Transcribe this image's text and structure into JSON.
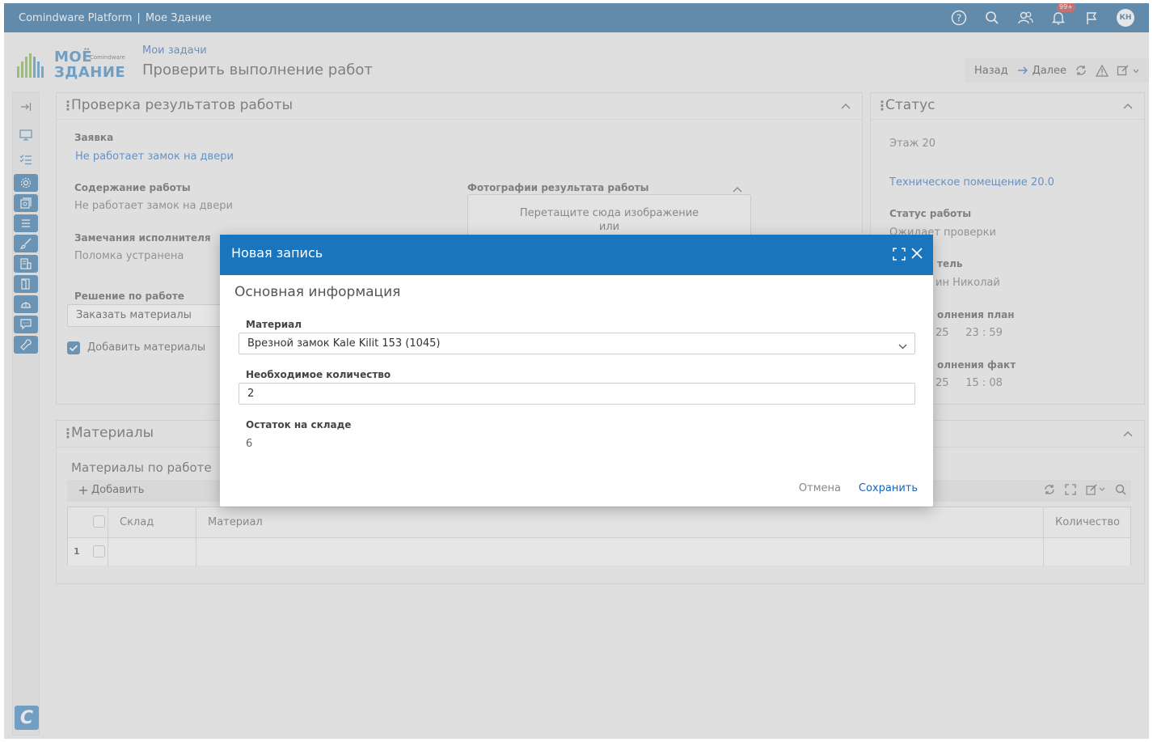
{
  "topbar": {
    "app_name": "Comindware Platform",
    "separator": "|",
    "workspace": "Мое Здание",
    "notification_count": "99+",
    "avatar_initials": "КН",
    "icons": [
      "help-icon",
      "search-icon",
      "users-icon",
      "bell-icon",
      "flag-icon"
    ]
  },
  "logo": {
    "line1": "МОЁ",
    "line2": "ЗДАНИЕ",
    "sub": "Comindware"
  },
  "header": {
    "breadcrumb": "Мои задачи",
    "title": "Проверить выполнение работ",
    "back_label": "Назад",
    "next_label": "Далее"
  },
  "panel_check": {
    "title": "Проверка результатов работы",
    "request_label": "Заявка",
    "request_value": "Не работает замок на двери",
    "content_label": "Содержание работы",
    "content_value": "Не работает замок на двери",
    "remarks_label": "Замечания исполнителя",
    "remarks_value": "Поломка устранена",
    "decision_label": "Решение по работе",
    "decision_value": "Заказать материалы",
    "add_materials_label": "Добавить материалы",
    "add_materials_checked": true,
    "photos_label": "Фотографии результата работы",
    "dropzone_line1": "Перетащите сюда изображение",
    "dropzone_line2": "или"
  },
  "panel_status": {
    "title": "Статус",
    "floor": "Этаж 20",
    "room": "Техническое помещение 20.0",
    "work_status_label": "Статус работы",
    "work_status_value": "Ожидает проверки",
    "executor_label_partial": "тель",
    "executor_value_partial": "ин Николай",
    "plan_label_partial": "олнения план",
    "plan_value_partial": "25     23 : 59",
    "fact_label_partial": "олнения факт",
    "fact_value_partial": "25     15 : 08"
  },
  "panel_materials": {
    "title": "Материалы",
    "subtitle": "Материалы по работе",
    "add_label": "Добавить",
    "columns": [
      "Склад",
      "Материал",
      "Количество"
    ],
    "rows": [
      {
        "num": "1",
        "warehouse": "",
        "material": "",
        "quantity": ""
      }
    ]
  },
  "modal": {
    "title": "Новая запись",
    "section": "Основная информация",
    "material_label": "Материал",
    "material_value": "Врезной замок Kale Kilit 153 (1045)",
    "quantity_label": "Необходимое количество",
    "quantity_value": "2",
    "stock_label": "Остаток на складе",
    "stock_value": "6",
    "cancel_label": "Отмена",
    "save_label": "Сохранить"
  },
  "colors": {
    "topbar": "#0f5a94",
    "modal_header": "#1a75bd",
    "link": "#1565c0",
    "sidebar_active": "#1f6aa5"
  }
}
